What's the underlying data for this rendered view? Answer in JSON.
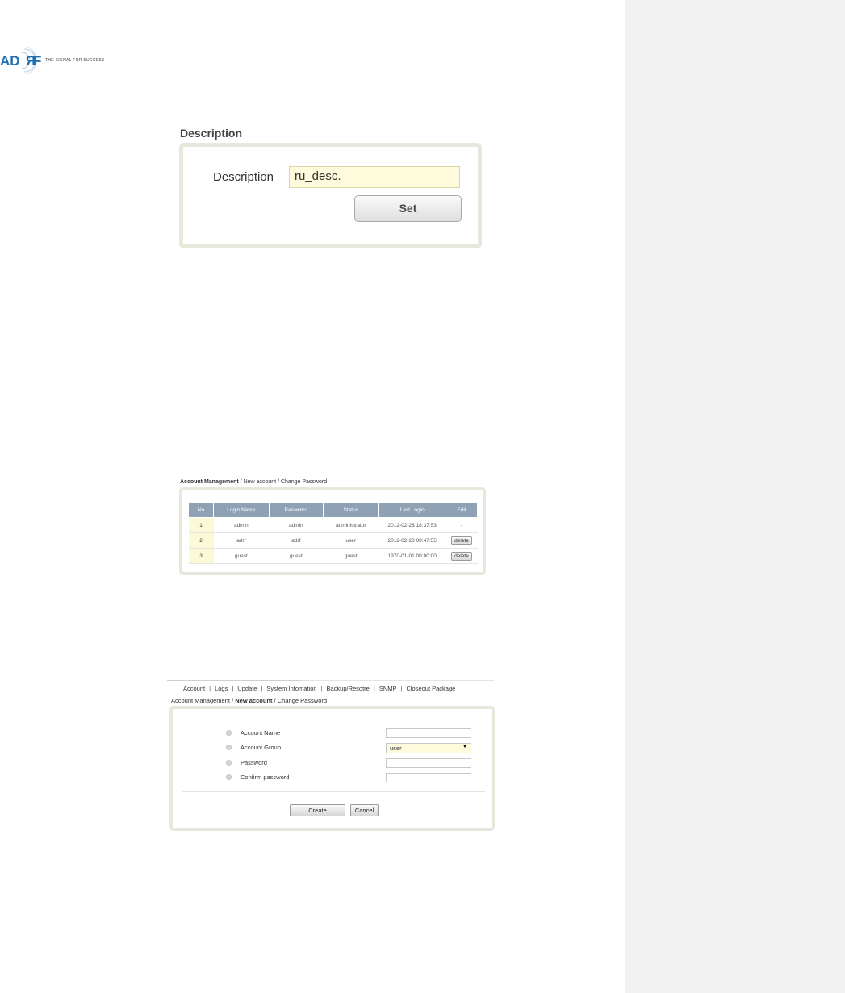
{
  "logo": {
    "brand": "ADRF",
    "tagline": "THE SIGNAL FOR SUCCESS",
    "brand_color": "#1f6fb2"
  },
  "description_panel": {
    "title": "Description",
    "field_label": "Description",
    "field_value": "ru_desc.",
    "set_label": "Set"
  },
  "account_table": {
    "nav": {
      "active": "Account Management",
      "links": [
        "New account",
        "Change Password"
      ]
    },
    "columns": [
      "No",
      "Login Name",
      "Password",
      "Status",
      "Last Login",
      "Edit"
    ],
    "rows": [
      {
        "no": "1",
        "login": "admin",
        "password": "admin",
        "status": "administrator",
        "last_login": "2012-02-28 18:37:53",
        "edit": "-"
      },
      {
        "no": "2",
        "login": "adrf",
        "password": "adrf",
        "status": "user",
        "last_login": "2012-02-28 00:47:55",
        "edit": "delete"
      },
      {
        "no": "3",
        "login": "guest",
        "password": "guest",
        "status": "guest",
        "last_login": "1970-01-01 00:00:00",
        "edit": "delete"
      }
    ]
  },
  "new_account_form": {
    "menu": [
      "Account",
      "Logs",
      "Update",
      "System Infomation",
      "Backup/Resotre",
      "SNMP",
      "Closeout Package"
    ],
    "nav": {
      "first": "Account Management",
      "active": "New account",
      "last": "Change Password"
    },
    "fields": {
      "account_name": {
        "label": "Account Name",
        "value": ""
      },
      "account_group": {
        "label": "Account Group",
        "value": "user"
      },
      "password": {
        "label": "Password",
        "value": ""
      },
      "confirm_password": {
        "label": "Confirm password",
        "value": ""
      }
    },
    "create_label": "Create",
    "cancel_label": "Cancel"
  }
}
